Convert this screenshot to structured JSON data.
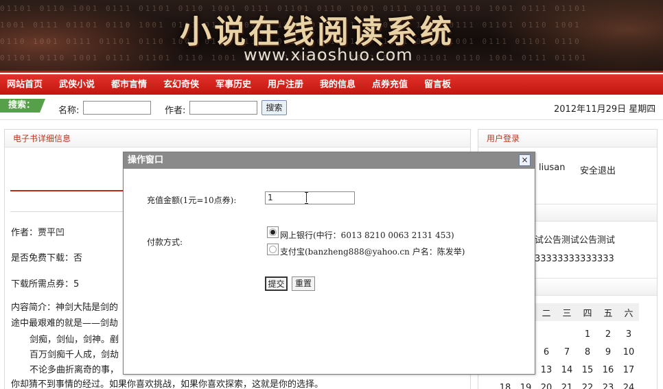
{
  "banner": {
    "title": "小说在线阅读系统",
    "url": "www.xiaoshuo.com"
  },
  "nav": {
    "items": [
      "网站首页",
      "武侠小说",
      "都市言情",
      "玄幻奇侠",
      "军事历史",
      "用户注册",
      "我的信息",
      "点券充值",
      "留言板"
    ]
  },
  "search": {
    "tag": "搜索：",
    "name_label": "名称:",
    "author_label": "作者:",
    "button": "搜索",
    "date": "2012年11月29日 星期四"
  },
  "left": {
    "header": "电子书详细信息",
    "author": "作者：贾平凹",
    "free": "是否免费下载：否",
    "points": "下载所需点券：5",
    "intro_1": "内容简介：神剑大陆是剑的",
    "intro_2": "途中最艰难的就是——剑劫",
    "intro_3": "剑痴，剑仙，剑神。剷",
    "intro_4": "百万剑痴千人成，剑劫",
    "intro_5": "不论多曲折离奇的事，",
    "intro_6": "你却猜不到事情的经过。如果你喜欢挑战，如果你喜欢探索，这就是你的选择。"
  },
  "right": {
    "header": "用户登录",
    "username": "liusan",
    "logout": "安全退出",
    "notice_1": "试公告测试公告测试",
    "notice_2": "33333333333333",
    "calendar": {
      "weekdays": [
        "二",
        "三",
        "四",
        "五",
        "六"
      ],
      "rows": [
        [
          "",
          "",
          "1",
          "2",
          "3"
        ],
        [
          "6",
          "7",
          "8",
          "9",
          "10"
        ],
        [
          "13",
          "14",
          "15",
          "16",
          "17"
        ]
      ],
      "partial_row": [
        "18",
        "19",
        "20",
        "21",
        "22",
        "23",
        "24"
      ]
    }
  },
  "modal": {
    "title": "操作窗口",
    "close": "×",
    "amount_label": "充值金额(1元=10点券):",
    "amount_value": "1",
    "pay_label": "付款方式:",
    "option_bank": "网上银行(中行：6013 8210 0063 2131 453)",
    "option_alipay": "支付宝(banzheng888@yahoo.cn 户名：陈发举)",
    "submit": "提交",
    "reset": "重置"
  }
}
